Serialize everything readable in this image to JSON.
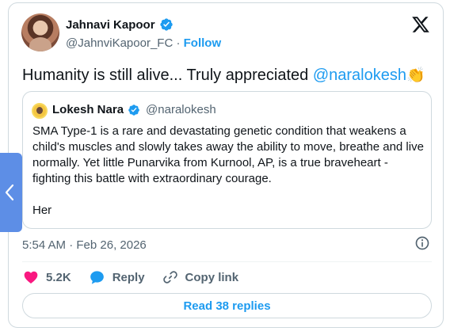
{
  "author": {
    "name": "Jahnavi Kapoor",
    "handle": "@JahnviKapoor_FC",
    "separator": " · ",
    "follow_label": "Follow"
  },
  "tweet": {
    "text": "Humanity is still alive... Truly appreciated ",
    "mention": "@naralokesh",
    "emoji": "👏"
  },
  "quoted": {
    "name": "Lokesh Nara",
    "handle": "@naralokesh",
    "paragraph1": "SMA Type-1 is a rare and devastating genetic condition that weakens a child's muscles and slowly takes away the ability to move, breathe and live normally. Yet little Punarvika from Kurnool, AP, is a true braveheart - fighting this battle with extraordinary courage.",
    "paragraph2": "Her"
  },
  "timestamp": "5:54 AM · Feb 26, 2026",
  "actions": {
    "likes": "5.2K",
    "reply_label": "Reply",
    "copy_label": "Copy link"
  },
  "read_replies_label": "Read 38 replies",
  "icons": {
    "verified": "verified-badge-icon",
    "logo": "x-logo-icon",
    "like": "heart-icon",
    "reply": "speech-bubble-icon",
    "copy": "link-icon",
    "info": "info-icon",
    "nav": "chevron-left-icon"
  },
  "colors": {
    "accent": "#1d9bf0",
    "like": "#f91880",
    "muted": "#536471",
    "text": "#0f1419",
    "border": "#cfd9de",
    "side_tab": "#5d8ee6"
  }
}
